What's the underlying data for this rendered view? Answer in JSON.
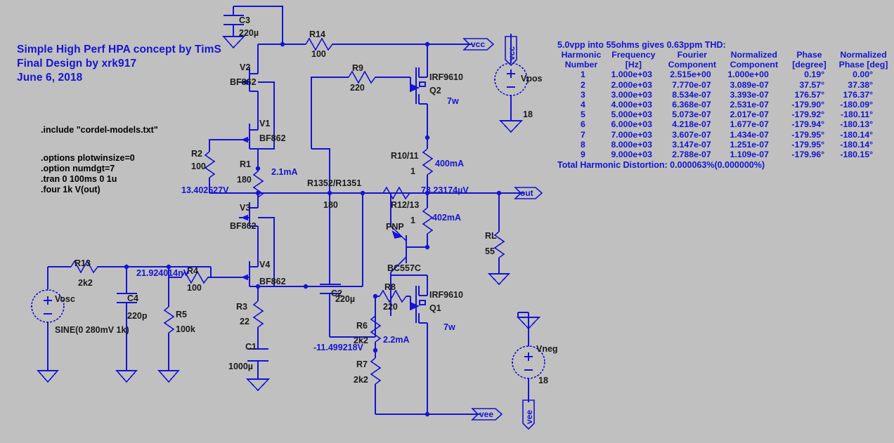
{
  "title_block": {
    "line1": "Simple High Perf HPA concept by TimS",
    "line2": "Final Design by xrk917",
    "line3": "June 6, 2018"
  },
  "spice_directives": {
    "include": ".include \"cordel-models.txt\"",
    "options1": ".options plotwinsize=0",
    "options2": ".option numdgt=7",
    "tran": ".tran 0 100ms 0 1u",
    "four": ".four 1k V(out)"
  },
  "fourier": {
    "heading": "5.0vpp into 55ohms gives 0.63ppm THD:",
    "columns": [
      [
        "Harmonic",
        "Number"
      ],
      [
        "Frequency",
        "[Hz]"
      ],
      [
        "Fourier",
        "Component"
      ],
      [
        "Normalized",
        "Component"
      ],
      [
        "Phase",
        "[degree]"
      ],
      [
        "Normalized",
        "Phase [deg]"
      ]
    ],
    "rows": [
      [
        "1",
        "1.000e+03",
        "2.515e+00",
        "1.000e+00",
        "0.19°",
        "0.00°"
      ],
      [
        "2",
        "2.000e+03",
        "7.770e-07",
        "3.089e-07",
        "37.57°",
        "37.38°"
      ],
      [
        "3",
        "3.000e+03",
        "8.534e-07",
        "3.393e-07",
        "176.57°",
        "176.37°"
      ],
      [
        "4",
        "4.000e+03",
        "6.368e-07",
        "2.531e-07",
        "-179.90°",
        "-180.09°"
      ],
      [
        "5",
        "5.000e+03",
        "5.073e-07",
        "2.017e-07",
        "-179.92°",
        "-180.11°"
      ],
      [
        "6",
        "6.000e+03",
        "4.218e-07",
        "1.677e-07",
        "-179.94°",
        "-180.13°"
      ],
      [
        "7",
        "7.000e+03",
        "3.607e-07",
        "1.434e-07",
        "-179.95°",
        "-180.14°"
      ],
      [
        "8",
        "8.000e+03",
        "3.147e-07",
        "1.251e-07",
        "-179.95°",
        "-180.14°"
      ],
      [
        "9",
        "9.000e+03",
        "2.788e-07",
        "1.109e-07",
        "-179.96°",
        "-180.15°"
      ]
    ],
    "thd": "Total Harmonic Distortion: 0.000063%(0.000000%)"
  },
  "components": {
    "c3": {
      "ref": "C3",
      "value": "220µ"
    },
    "c4": {
      "ref": "C4",
      "value": "220p"
    },
    "c2": {
      "ref": "C2",
      "value": "220µ"
    },
    "c1": {
      "ref": "C1",
      "value": "1000µ"
    },
    "r14": {
      "ref": "R14",
      "value": "100"
    },
    "r9": {
      "ref": "R9",
      "value": "220"
    },
    "r2": {
      "ref": "R2",
      "value": "100"
    },
    "r1": {
      "ref": "R1",
      "value": "180"
    },
    "r1352": {
      "ref": "R1352/R1351",
      "value": "180"
    },
    "r1011": {
      "ref": "R10/11",
      "value": "1"
    },
    "r1213": {
      "ref": "R12/13",
      "value": "1"
    },
    "rl": {
      "ref": "RL",
      "value": "55"
    },
    "r13": {
      "ref": "R13",
      "value": "2k2"
    },
    "r5": {
      "ref": "R5",
      "value": "100k"
    },
    "r4": {
      "ref": "R4",
      "value": "100"
    },
    "r3": {
      "ref": "R3",
      "value": "22"
    },
    "r8": {
      "ref": "R8",
      "value": "220"
    },
    "r6": {
      "ref": "R6",
      "value": "2k2"
    },
    "r7": {
      "ref": "R7",
      "value": "2k2"
    },
    "v1": {
      "ref": "V1",
      "model": "BF862"
    },
    "v2": {
      "ref": "V2",
      "model": "BF862"
    },
    "v3": {
      "ref": "V3",
      "model": "BF862"
    },
    "v4": {
      "ref": "V4",
      "model": "BF862"
    },
    "q2": {
      "ref": "Q2",
      "model": "IRF9610",
      "power": "7w"
    },
    "q1": {
      "ref": "Q1",
      "model": "IRF9610",
      "power": "7w"
    },
    "pnp": {
      "ref": "PNP",
      "model": "BC557C"
    },
    "vosc": {
      "ref": "Vosc",
      "value": "SINE(0 280mV 1k)"
    },
    "vpos": {
      "ref": "Vpos",
      "value": "18"
    },
    "vneg": {
      "ref": "Vneg",
      "value": "18"
    }
  },
  "flags": {
    "vcc": "vcc",
    "vcc_supply": "vcc",
    "out": "out",
    "vee": "vee",
    "vee_supply": "vee"
  },
  "annotations": {
    "i_r1": "2.1mA",
    "v_node_jfet": "13.402527V",
    "i_r1011": "400mA",
    "i_r1213": "402mA",
    "v_out": "73.23174µV",
    "v_in": "21.924014nV",
    "i_r6": "2.2mA",
    "v_r6r7": "-11.499218V",
    "q2_power": "7w",
    "q1_power": "7w"
  },
  "colors": {
    "background": "#c0c0c0",
    "wire": "#1414d2",
    "component_text": "#1a1a1a",
    "annotation_text": "#1414d2"
  }
}
